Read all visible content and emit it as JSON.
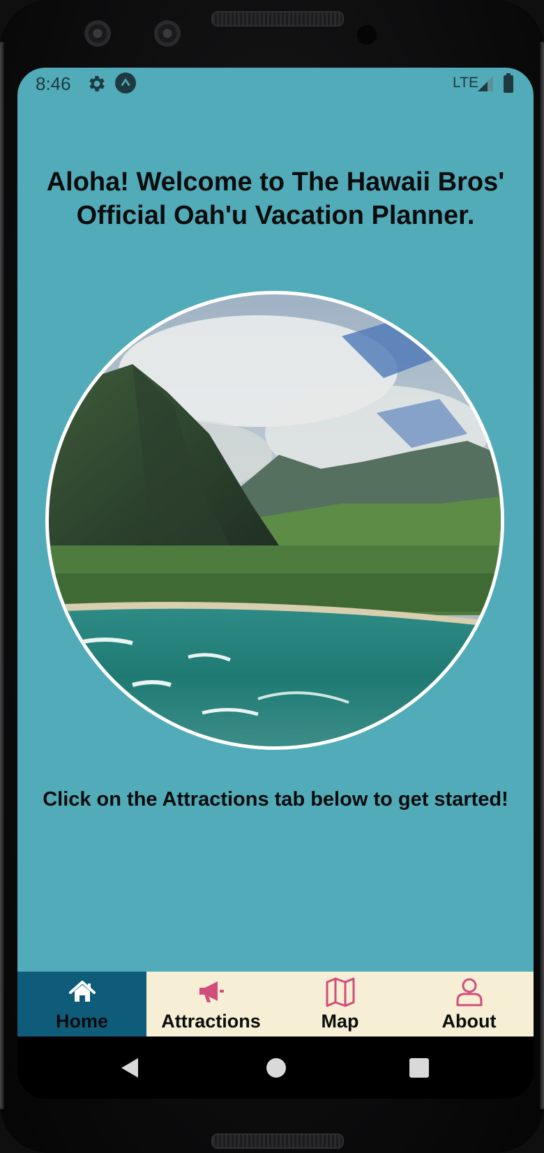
{
  "status_bar": {
    "time": "8:46",
    "network": "LTE",
    "icons": [
      "gear-icon",
      "app-notification-icon",
      "signal-icon",
      "battery-icon"
    ]
  },
  "home": {
    "title": "Aloha! Welcome to The Hawaii Bros' Official Oah'u Vacation Planner.",
    "hero_image_description_icon": "landscape-photo",
    "instructions": "Click on the Attractions tab below to get started!"
  },
  "tabs": [
    {
      "label": "Home",
      "icon": "home-icon",
      "active": true
    },
    {
      "label": "Attractions",
      "icon": "megaphone-icon",
      "active": false
    },
    {
      "label": "Map",
      "icon": "map-icon",
      "active": false
    },
    {
      "label": "About",
      "icon": "user-icon",
      "active": false
    }
  ],
  "colors": {
    "app_background": "#52abb9",
    "tab_bar_background": "#f6efd5",
    "tab_active_background": "#0f5c7a",
    "tab_icon_inactive": "#d14d7b",
    "tab_icon_active": "#ffffff",
    "text": "#0c0c0c"
  }
}
